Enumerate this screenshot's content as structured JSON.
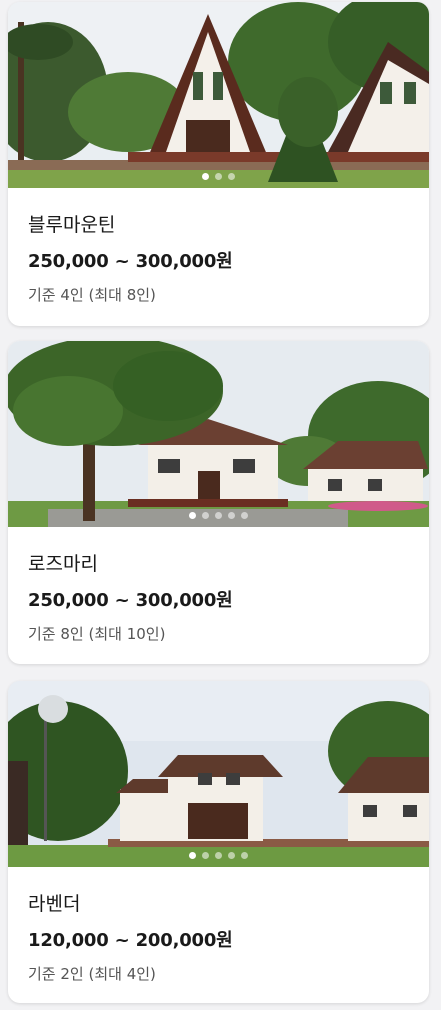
{
  "rooms": [
    {
      "name": "블루마운틴",
      "price": "250,000 ~ 300,000원",
      "capacity": "기준 4인 (최대 8인)",
      "photo_count": 3,
      "active_photo": 1
    },
    {
      "name": "로즈마리",
      "price": "250,000 ~ 300,000원",
      "capacity": "기준 8인 (최대 10인)",
      "photo_count": 5,
      "active_photo": 1
    },
    {
      "name": "라벤더",
      "price": "120,000 ~ 200,000원",
      "capacity": "기준 2인 (최대 4인)",
      "photo_count": 5,
      "active_photo": 1
    }
  ],
  "colors": {
    "card_bg": "#ffffff",
    "page_bg": "#f2f2f4",
    "text_primary": "#1a1a1a",
    "text_secondary": "#555555",
    "dot_active": "#ffffff"
  }
}
